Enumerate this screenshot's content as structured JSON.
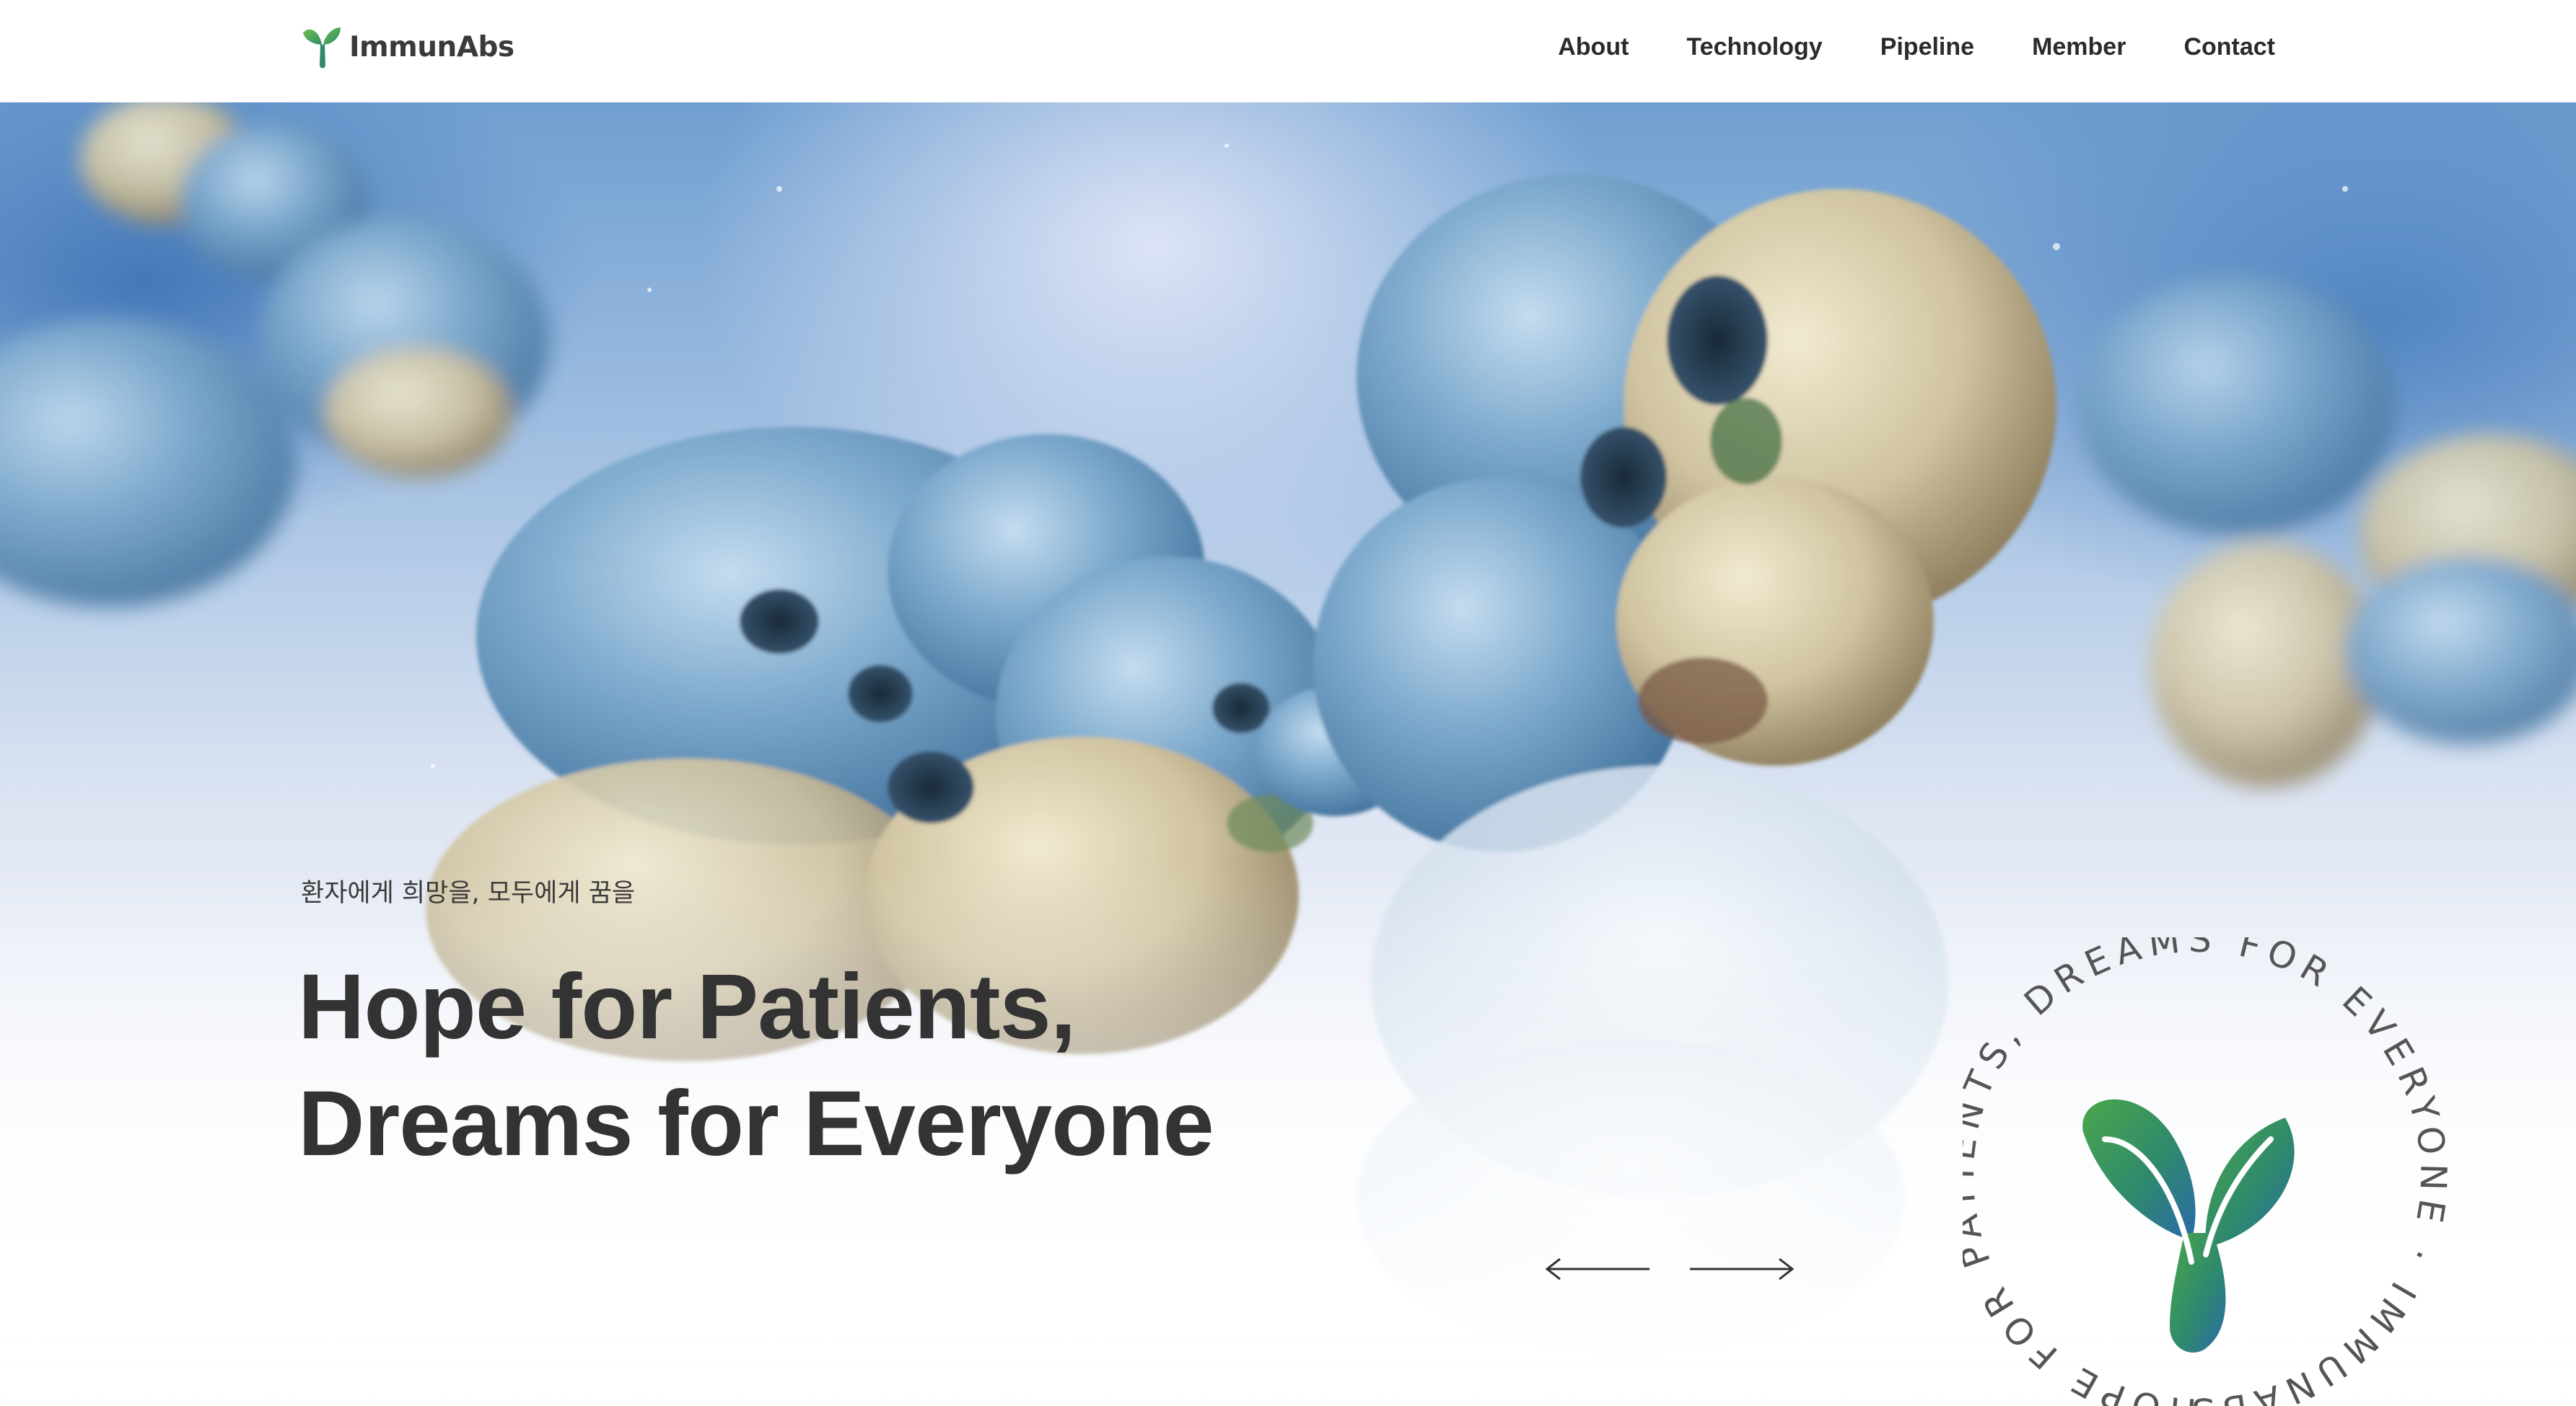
{
  "header": {
    "brand": "ImmunAbs",
    "nav": [
      "About",
      "Technology",
      "Pipeline",
      "Member",
      "Contact"
    ]
  },
  "hero": {
    "subtitle": "환자에게 희망을, 모두에게 꿈을",
    "title_line1": "Hope for Patients,",
    "title_line2": "Dreams for Everyone",
    "badge_text": "HOPE FOR PATIENTS, DREAMS FOR EVERYONE · IMMUNABS"
  },
  "icons": {
    "logo": "y-sprout-logo-icon",
    "prev": "arrow-left-icon",
    "next": "arrow-right-icon",
    "badge": "y-antibody-icon"
  },
  "colors": {
    "brand_green": "#4a9b4f",
    "brand_teal": "#2f7aa0",
    "title_text": "#333333",
    "hero_blue": "#6f9fd0"
  }
}
